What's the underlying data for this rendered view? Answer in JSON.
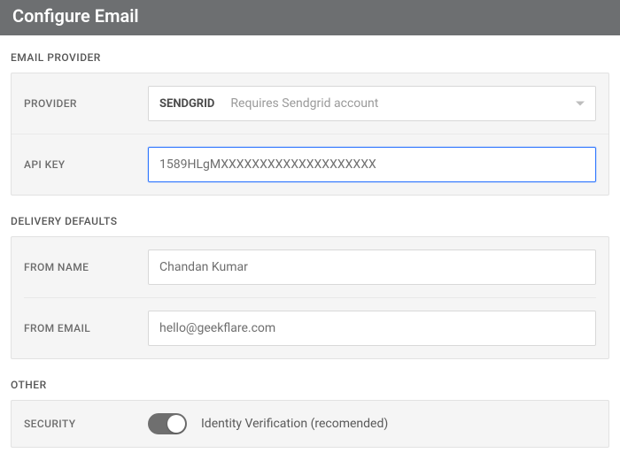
{
  "header": {
    "title": "Configure Email"
  },
  "sections": {
    "provider": {
      "label": "EMAIL PROVIDER",
      "rows": {
        "provider": {
          "label": "PROVIDER",
          "selected": "SENDGRID",
          "hint": "Requires Sendgrid account"
        },
        "api_key": {
          "label": "API KEY",
          "value": "1589HLgMXXXXXXXXXXXXXXXXXXXX"
        }
      }
    },
    "delivery": {
      "label": "DELIVERY DEFAULTS",
      "rows": {
        "from_name": {
          "label": "FROM NAME",
          "value": "Chandan Kumar"
        },
        "from_email": {
          "label": "FROM EMAIL",
          "value": "hello@geekflare.com"
        }
      }
    },
    "other": {
      "label": "OTHER",
      "rows": {
        "security": {
          "label": "SECURITY",
          "toggle_on": true,
          "toggle_label": "Identity Verification (recomended)"
        }
      }
    }
  }
}
